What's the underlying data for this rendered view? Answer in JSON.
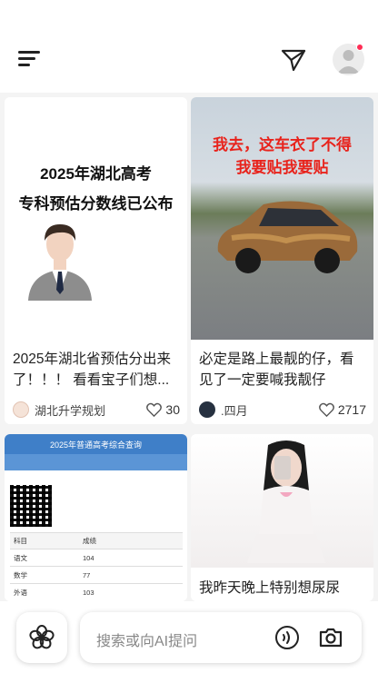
{
  "header": {
    "menu_icon": "menu-icon",
    "send_icon": "paper-plane-icon",
    "avatar_icon": "user-avatar-icon",
    "notification_color": "#ff2d55"
  },
  "feed": [
    {
      "image_caption_line1": "2025年湖北高考",
      "image_caption_line2": "专科预估分数线已公布",
      "title_line1": "2025年湖北省预估分出来",
      "title_line2": "了！！！ 看看宝子们想...",
      "author": "湖北升学规划",
      "likes": "30"
    },
    {
      "image_caption_line1": "我去，这车衣了不得",
      "image_caption_line2": "我要贴我要贴",
      "title_line1": "必定是路上最靓的仔，看",
      "title_line2": "见了一定要喊我靓仔",
      "author": ".四月",
      "likes": "2717"
    },
    {
      "image_header": "2025年普通高考综合查询",
      "table_header": [
        "科目",
        "成绩"
      ],
      "table_rows": [
        [
          "语文",
          "104"
        ],
        [
          "数学",
          "77"
        ],
        [
          "外语",
          "103"
        ]
      ]
    },
    {
      "title_line1": "我昨天晚上特别想尿尿"
    }
  ],
  "bottom": {
    "flower_icon": "flower-icon",
    "search_placeholder": "搜索或向AI提问",
    "voice_icon": "voice-icon",
    "camera_icon": "camera-icon"
  }
}
